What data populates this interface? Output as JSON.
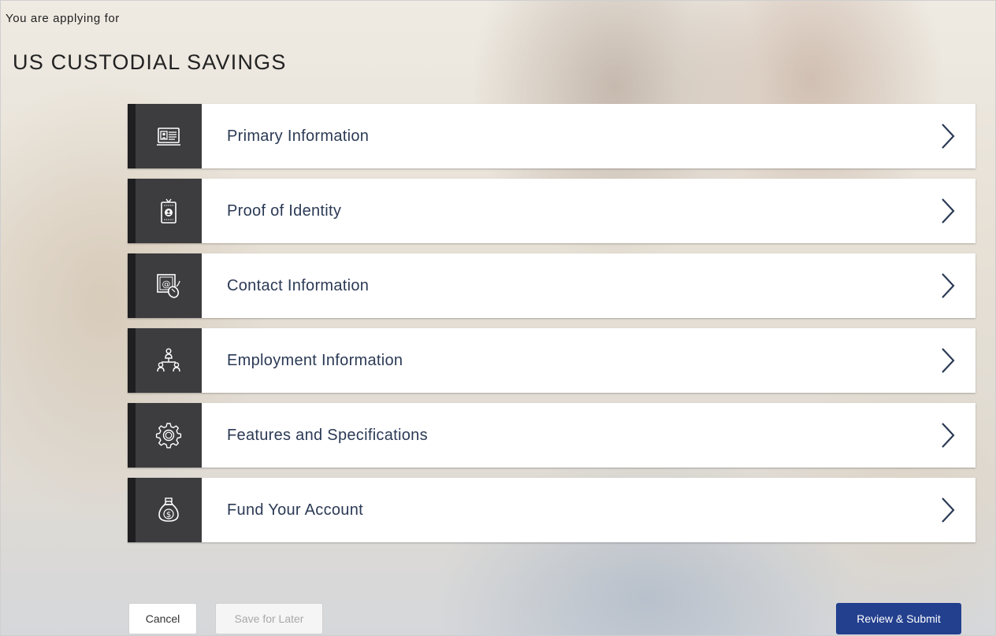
{
  "header": {
    "intro_text": "You are applying for",
    "product_title": "US CUSTODIAL SAVINGS"
  },
  "sections": [
    {
      "label": "Primary Information",
      "icon": "id-card-icon"
    },
    {
      "label": "Proof of Identity",
      "icon": "id-badge-icon"
    },
    {
      "label": "Contact Information",
      "icon": "contact-at-mouse-icon"
    },
    {
      "label": "Employment Information",
      "icon": "org-hierarchy-icon"
    },
    {
      "label": "Features and Specifications",
      "icon": "gear-icon"
    },
    {
      "label": "Fund Your Account",
      "icon": "money-bag-icon"
    }
  ],
  "actions": {
    "cancel_label": "Cancel",
    "save_label": "Save for Later",
    "submit_label": "Review & Submit"
  },
  "colors": {
    "icon_panel": "#3d3d3f",
    "icon_panel_edge": "#1f1f21",
    "label_text": "#2b3a55",
    "primary_button": "#23408e"
  }
}
